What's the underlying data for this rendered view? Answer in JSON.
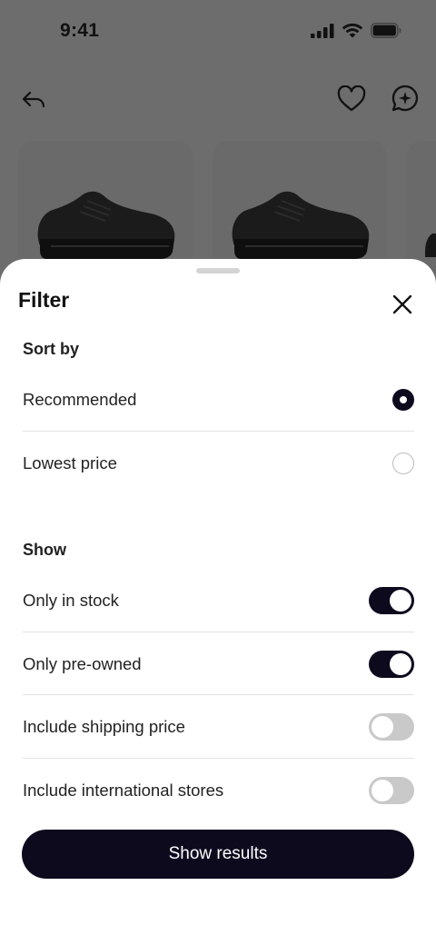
{
  "status_bar": {
    "time": "9:41"
  },
  "icons": {
    "back": "back-arrow-icon",
    "favorite": "heart-icon",
    "ai": "sparkle-chat-icon",
    "close": "close-icon"
  },
  "filter": {
    "title": "Filter",
    "sort_section": {
      "label": "Sort by",
      "options": [
        {
          "label": "Recommended",
          "selected": true
        },
        {
          "label": "Lowest price",
          "selected": false
        }
      ]
    },
    "show_section": {
      "label": "Show",
      "toggles": [
        {
          "label": "Only in stock",
          "on": true
        },
        {
          "label": "Only pre-owned",
          "on": true
        },
        {
          "label": "Include shipping price",
          "on": false
        },
        {
          "label": "Include international stores",
          "on": false
        }
      ]
    },
    "submit_label": "Show results"
  },
  "colors": {
    "accent": "#0d0a1e",
    "toggle_off": "#c9c9c9",
    "backdrop": "#6d6d6d"
  }
}
